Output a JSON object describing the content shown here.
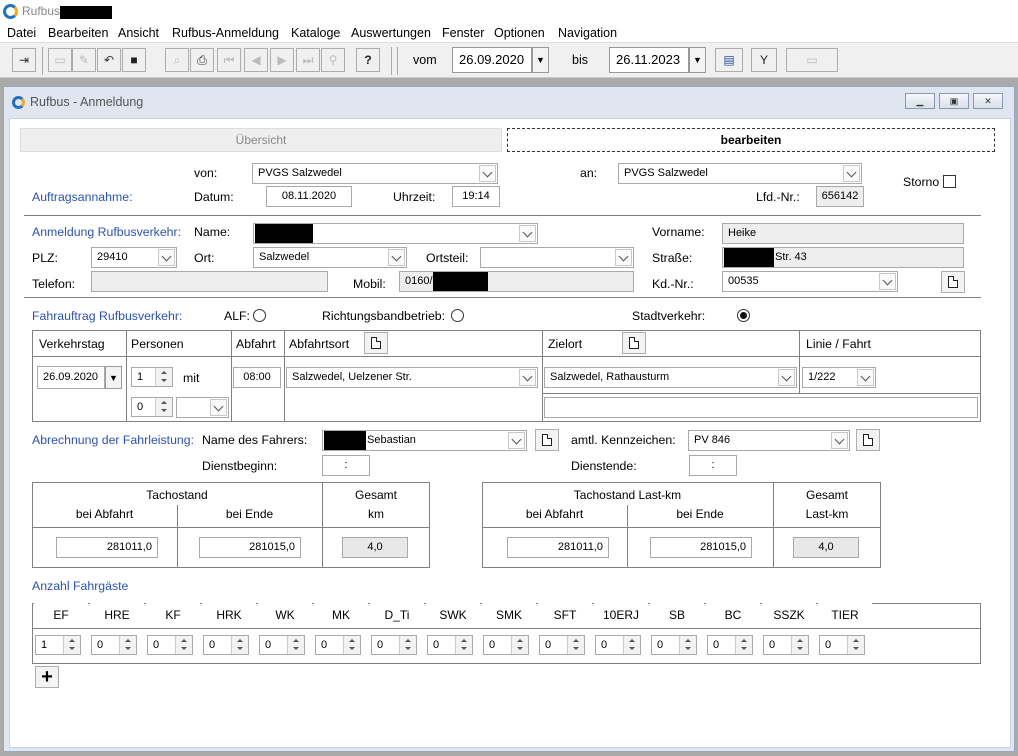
{
  "app": {
    "title": "Rufbus"
  },
  "menu": [
    "Datei",
    "Bearbeiten",
    "Ansicht",
    "Rufbus-Anmeldung",
    "Kataloge",
    "Auswertungen",
    "Fenster",
    "Optionen",
    "Navigation"
  ],
  "toolbar": {
    "vom_label": "vom",
    "vom_value": "26.09.2020",
    "bis_label": "bis",
    "bis_value": "26.11.2023",
    "help": "?"
  },
  "window": {
    "title": "Rufbus - Anmeldung"
  },
  "tabs": {
    "overview": "Übersicht",
    "edit": "bearbeiten"
  },
  "auftrag": {
    "section": "Auftragsannahme:",
    "von_label": "von:",
    "von_value": "PVGS Salzwedel",
    "an_label": "an:",
    "an_value": "PVGS Salzwedel",
    "storno_label": "Storno",
    "datum_label": "Datum:",
    "datum_value": "08.11.2020",
    "uhrzeit_label": "Uhrzeit:",
    "uhrzeit_value": "19:14",
    "lfdnr_label": "Lfd.-Nr.:",
    "lfdnr_value": "656142"
  },
  "anmeldung": {
    "section": "Anmeldung Rufbusverkehr:",
    "name_label": "Name:",
    "vorname_label": "Vorname:",
    "vorname_value": "Heike",
    "plz_label": "PLZ:",
    "plz_value": "29410",
    "ort_label": "Ort:",
    "ort_value": "Salzwedel",
    "ortsteil_label": "Ortsteil:",
    "ortsteil_value": "",
    "strasse_label": "Straße:",
    "strasse_value": "Str. 43",
    "telefon_label": "Telefon:",
    "mobil_label": "Mobil:",
    "mobil_value": "0160/",
    "kdnr_label": "Kd.-Nr.:",
    "kdnr_value": "00535"
  },
  "fahrauftrag": {
    "section": "Fahrauftrag Rufbusverkehr:",
    "alf_label": "ALF:",
    "richtung_label": "Richtungsbandbetrieb:",
    "stadt_label": "Stadtverkehr:",
    "selected": "Stadtverkehr",
    "headers": {
      "verkehrstag": "Verkehrstag",
      "personen": "Personen",
      "abfahrt": "Abfahrt",
      "abfahrtsort": "Abfahrtsort",
      "zielort": "Zielort",
      "linie": "Linie / Fahrt"
    },
    "verkehrstag": "26.09.2020",
    "personen": "1",
    "mit": "mit",
    "personen2": "0",
    "abfahrt": "08:00",
    "abfahrtsort": "Salzwedel, Uelzener Str.",
    "zielort": "Salzwedel, Rathausturm",
    "linie": "1/222"
  },
  "abrechnung": {
    "section": "Abrechnung der Fahrleistung:",
    "fahrer_label": "Name des Fahrers:",
    "fahrer_value": "Sebastian",
    "kennzeichen_label": "amtl. Kennzeichen:",
    "kennzeichen_value": "PV 846",
    "dienstbeginn_label": "Dienstbeginn:",
    "dienstbeginn_value": ":",
    "dienstende_label": "Dienstende:",
    "dienstende_value": ":"
  },
  "tacho": {
    "title": "Tachostand",
    "bei_abfahrt": "bei Abfahrt",
    "bei_ende": "bei Ende",
    "gesamt": "Gesamt",
    "km": "km",
    "abfahrt_value": "281011,0",
    "ende_value": "281015,0",
    "gesamt_value": "4,0"
  },
  "tacho_last": {
    "title": "Tachostand Last-km",
    "bei_abfahrt": "bei Abfahrt",
    "bei_ende": "bei Ende",
    "gesamt": "Gesamt",
    "unit": "Last-km",
    "abfahrt_value": "281011,0",
    "ende_value": "281015,0",
    "gesamt_value": "4,0"
  },
  "fahrgaeste": {
    "section": "Anzahl Fahrgäste",
    "columns": [
      {
        "h": "EF",
        "v": "1"
      },
      {
        "h": "HRE",
        "v": "0"
      },
      {
        "h": "KF",
        "v": "0"
      },
      {
        "h": "HRK",
        "v": "0"
      },
      {
        "h": "WK",
        "v": "0"
      },
      {
        "h": "MK",
        "v": "0"
      },
      {
        "h": "D_Ti",
        "v": "0"
      },
      {
        "h": "SWK",
        "v": "0"
      },
      {
        "h": "SMK",
        "v": "0"
      },
      {
        "h": "SFT",
        "v": "0"
      },
      {
        "h": "10ERJ",
        "v": "0"
      },
      {
        "h": "SB",
        "v": "0"
      },
      {
        "h": "BC",
        "v": "0"
      },
      {
        "h": "SSZK",
        "v": "0"
      },
      {
        "h": "TIER",
        "v": "0"
      }
    ],
    "add_label": "+"
  }
}
